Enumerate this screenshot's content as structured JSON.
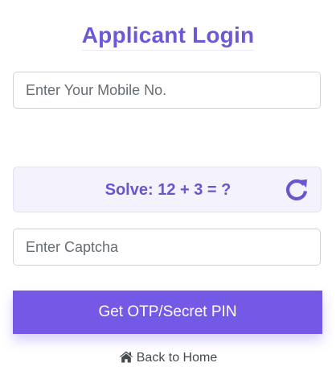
{
  "header": {
    "title": "Applicant Login"
  },
  "form": {
    "mobile_placeholder": "Enter Your Mobile No.",
    "captcha_question": "Solve: 12 + 3 = ?",
    "captcha_placeholder": "Enter Captcha",
    "submit_label": "Get OTP/Secret PIN",
    "back_label": "Back to Home"
  },
  "icons": {
    "refresh": "refresh-icon",
    "home": "home-icon"
  },
  "colors": {
    "accent": "#7459e6",
    "title": "#6f58d6",
    "captcha_bg": "#f4f2fd"
  }
}
